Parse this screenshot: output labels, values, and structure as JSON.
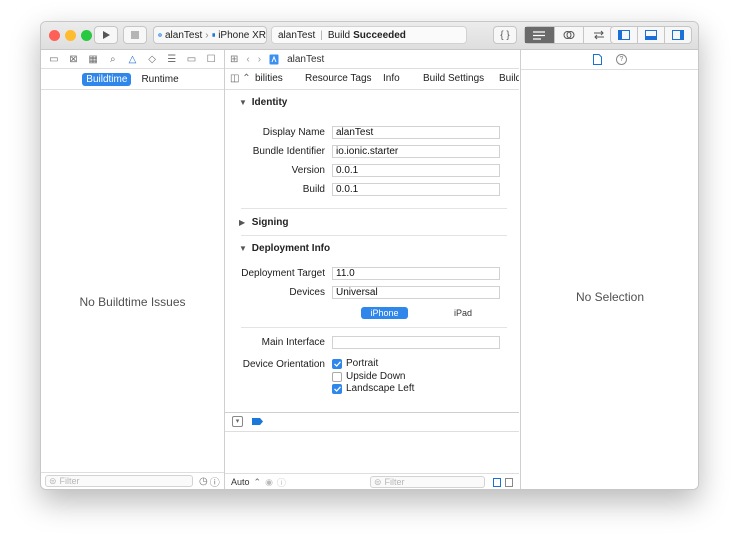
{
  "toolbar": {
    "scheme_project": "alanTest",
    "scheme_device": "iPhone XR",
    "status_project": "alanTest",
    "status_separator": "|",
    "status_prefix": "Build",
    "status_result": "Succeeded"
  },
  "colors": {
    "close": "#fe5f57",
    "minimize": "#febc2e",
    "zoom": "#28c840",
    "accent": "#2f86eb"
  },
  "navigator": {
    "tabs": [
      {
        "label": "Buildtime",
        "selected": true
      },
      {
        "label": "Runtime",
        "selected": false
      }
    ],
    "empty_message": "No Buildtime Issues",
    "filter_placeholder": "Filter"
  },
  "editor": {
    "breadcrumb": "alanTest",
    "tabs": [
      "bilities",
      "Resource Tags",
      "Info",
      "Build Settings",
      "Build"
    ],
    "identity": {
      "title": "Identity",
      "display_name_label": "Display Name",
      "display_name": "alanTest",
      "bundle_id_label": "Bundle Identifier",
      "bundle_id": "io.ionic.starter",
      "version_label": "Version",
      "version": "0.0.1",
      "build_label": "Build",
      "build": "0.0.1"
    },
    "signing": {
      "title": "Signing"
    },
    "deployment": {
      "title": "Deployment Info",
      "target_label": "Deployment Target",
      "target": "11.0",
      "devices_label": "Devices",
      "devices": "Universal",
      "device_options": [
        "iPhone",
        "iPad"
      ],
      "main_interface_label": "Main Interface",
      "main_interface": "",
      "orientation_label": "Device Orientation",
      "orientations": [
        {
          "label": "Portrait",
          "checked": true
        },
        {
          "label": "Upside Down",
          "checked": false
        },
        {
          "label": "Landscape Left",
          "checked": true
        }
      ]
    },
    "debug": {
      "auto_label": "Auto",
      "filter_placeholder": "Filter"
    }
  },
  "inspector": {
    "empty_message": "No Selection"
  }
}
